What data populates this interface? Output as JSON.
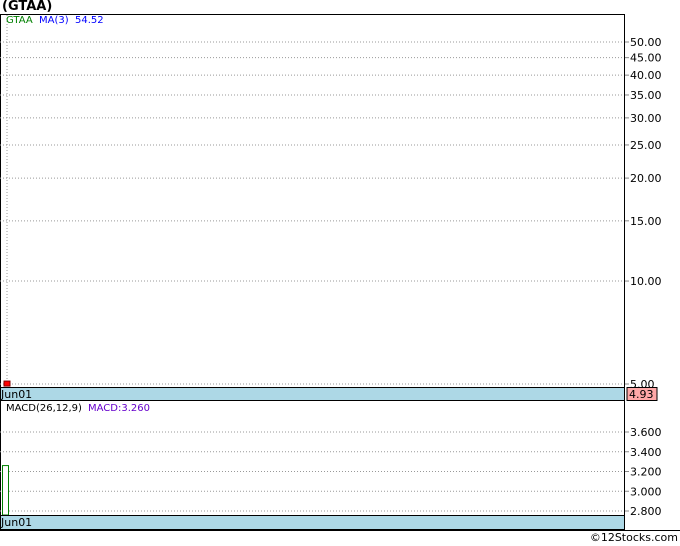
{
  "title": "(GTAA)",
  "legend": {
    "symbol": "GTAA",
    "ma_label": "MA(3)",
    "ma_value": "54.52"
  },
  "macd_legend": {
    "label": "MACD(26,12,9)",
    "value_label": "MACD:3.260"
  },
  "credit": "©12Stocks.com",
  "colors": {
    "symbol": "#008000",
    "ma": "#0000ff",
    "macd_value": "#6600cc",
    "axis_strip": "#add8e6",
    "last_price_bg": "#ffa8a8",
    "candle": "#ff0000",
    "macd_bar": "#008000"
  },
  "chart_data": [
    {
      "type": "candlestick",
      "scale": "log",
      "ylim": [
        4.93,
        55
      ],
      "yticks": [
        5.0,
        10.0,
        15.0,
        20.0,
        25.0,
        30.0,
        35.0,
        40.0,
        45.0,
        50.0
      ],
      "ytick_labels": [
        "5.00",
        "10.00",
        "15.00",
        "20.00",
        "25.00",
        "30.00",
        "35.00",
        "40.00",
        "45.00",
        "50.00"
      ],
      "x_labels": [
        "Jun01"
      ],
      "points": [
        {
          "date": "Jun01",
          "open": 5.1,
          "high": 5.1,
          "low": 4.93,
          "close": 4.93
        }
      ],
      "last_price": "4.93",
      "grid": true
    },
    {
      "type": "bar",
      "name": "MACD",
      "ylim": [
        2.76,
        3.76
      ],
      "yticks": [
        2.8,
        3.0,
        3.2,
        3.4,
        3.6
      ],
      "ytick_labels": [
        "2.800",
        "3.000",
        "3.200",
        "3.400",
        "3.600"
      ],
      "x_labels": [
        "Jun01"
      ],
      "values": [
        3.26
      ],
      "grid": true
    }
  ]
}
